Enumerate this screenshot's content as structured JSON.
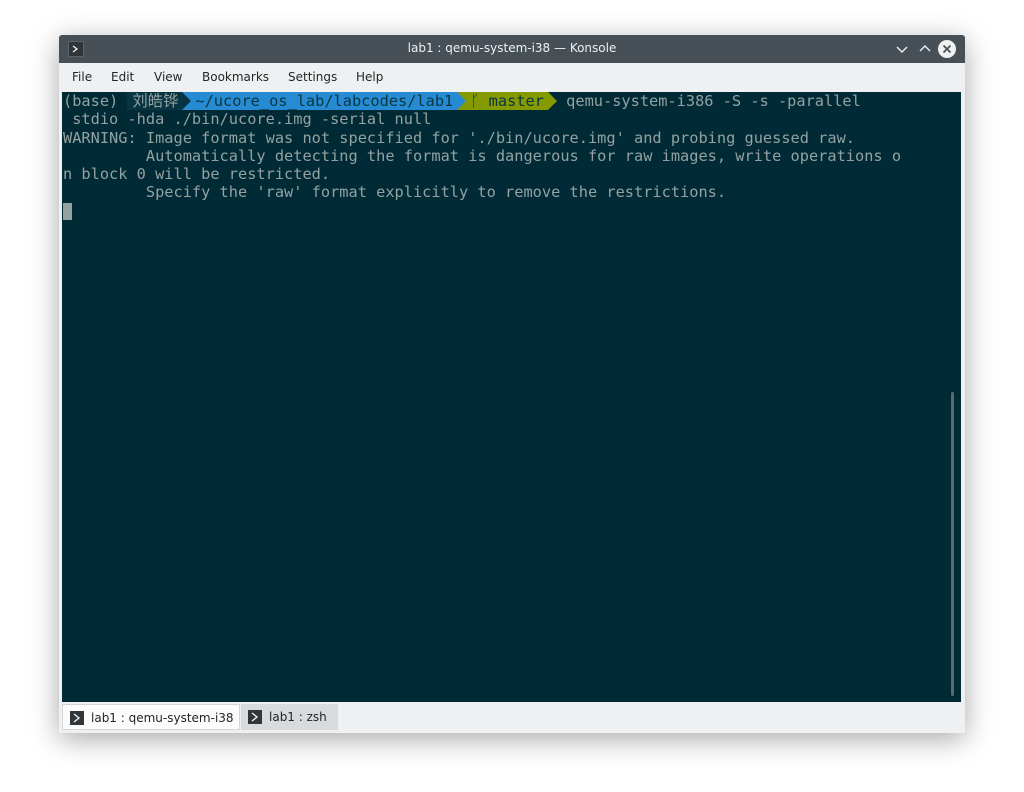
{
  "window": {
    "title": "lab1 : qemu-system-i38 — Konsole"
  },
  "menubar": {
    "items": [
      "File",
      "Edit",
      "View",
      "Bookmarks",
      "Settings",
      "Help"
    ]
  },
  "terminal": {
    "prompt": {
      "env": "(base)",
      "user": "刘皓铧",
      "path": "~/ucore_os_lab/labcodes/lab1",
      "git_glyph": "ᚴ",
      "git_branch": "master"
    },
    "command_line_1": " qemu-system-i386 -S -s -parallel",
    "command_line_2": " stdio -hda ./bin/ucore.img -serial null",
    "output": [
      "WARNING: Image format was not specified for './bin/ucore.img' and probing guessed raw.",
      "         Automatically detecting the format is dangerous for raw images, write operations o",
      "n block 0 will be restricted.",
      "         Specify the 'raw' format explicitly to remove the restrictions."
    ]
  },
  "tabs": [
    {
      "label": "lab1 : qemu-system-i38",
      "active": true
    },
    {
      "label": "lab1 : zsh",
      "active": false
    }
  ],
  "colors": {
    "terminal_bg": "#002b36",
    "terminal_fg": "#93a1a1",
    "prompt_user_bg": "#073642",
    "prompt_path_bg": "#268bd2",
    "prompt_git_bg": "#859900",
    "titlebar_bg": "#475057"
  }
}
